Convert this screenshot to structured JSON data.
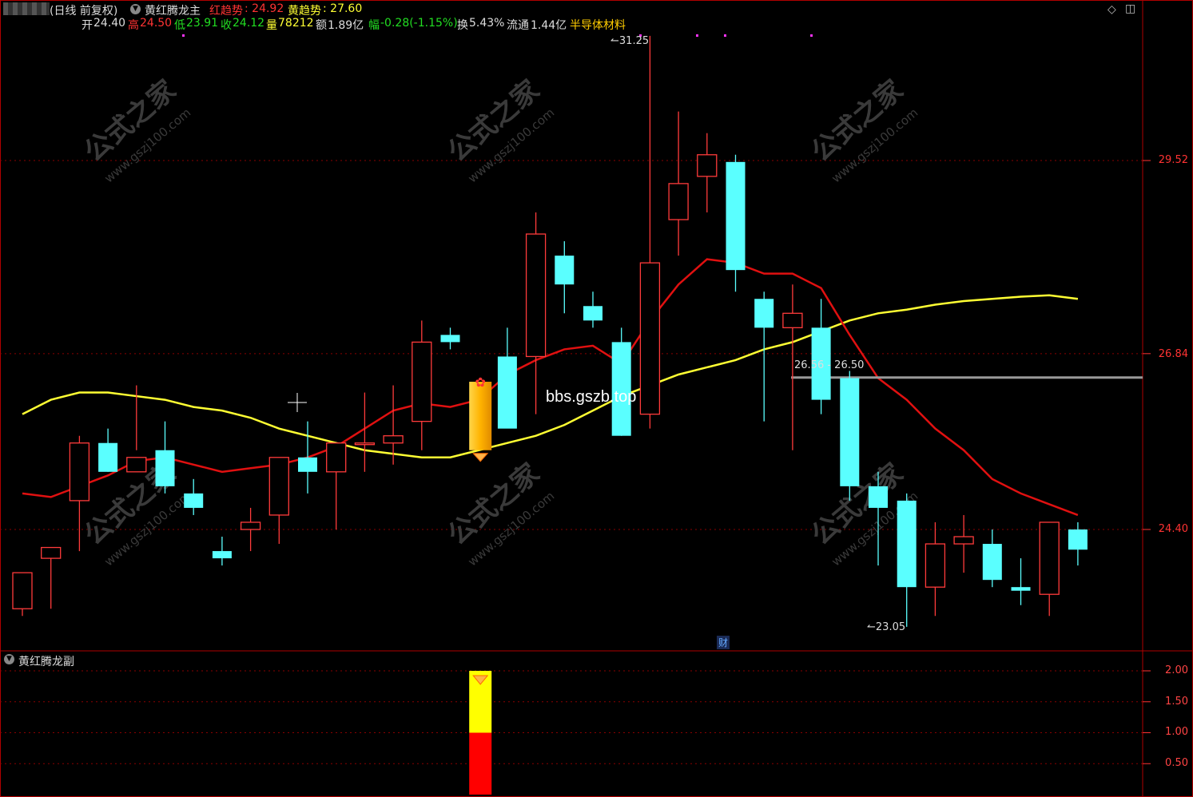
{
  "header": {
    "period_label": "(日线 前复权)",
    "indicator_name": "黄红腾龙主",
    "red_trend_label": "红趋势",
    "red_trend_value": ": 24.92",
    "yellow_trend_label": "黄趋势",
    "yellow_trend_value": ": 27.60"
  },
  "quote": {
    "open_label": "开",
    "open_value": "24.40",
    "high_label": "高",
    "high_value": "24.50",
    "low_label": "低",
    "low_value": "23.91",
    "close_label": "收",
    "close_value": "24.12",
    "volume_label": "量",
    "volume_value": "78212",
    "amount_label": "额",
    "amount_value": "1.89亿",
    "change_label": "幅",
    "change_value": "-0.28(-1.15%)",
    "turnover_label": "换",
    "turnover_value": "5.43%",
    "float_label": "流通",
    "float_value": "1.44亿",
    "sector": "半导体材料"
  },
  "main_axis": {
    "labels": [
      "29.52",
      "26.84",
      "24.40"
    ]
  },
  "annotations": {
    "high_marker": "31.25",
    "low_marker": "23.05",
    "price_range": "26.56 - 26.50",
    "watermark_center": "bbs.gszb.top",
    "finance_badge": "财",
    "watermark_cn": "公式之家",
    "watermark_url": "www.gszj100.com"
  },
  "sub_panel": {
    "indicator_name": "黄红腾龙副",
    "axis_labels": [
      "2.00",
      "1.50",
      "1.00",
      "0.50"
    ],
    "bar_total": 2.0,
    "bar_red": 1.0,
    "bar_yellow": 1.0
  },
  "colors": {
    "up": "#ff3b3b",
    "down": "#5affff",
    "red_line": "#e01010",
    "yellow_line": "#ffff33",
    "grid": "#8b0000",
    "signal_gold": "#ffb300"
  },
  "chart_data": {
    "type": "candlestick",
    "y_axis_ticks": [
      24.4,
      26.84,
      29.52
    ],
    "candles": [
      {
        "o": 23.3,
        "h": 23.7,
        "l": 23.2,
        "c": 23.8
      },
      {
        "o": 24.0,
        "h": 24.1,
        "l": 23.3,
        "c": 24.15
      },
      {
        "o": 24.8,
        "h": 25.7,
        "l": 24.1,
        "c": 25.6
      },
      {
        "o": 25.6,
        "h": 25.8,
        "l": 25.2,
        "c": 25.2
      },
      {
        "o": 25.2,
        "h": 26.4,
        "l": 25.5,
        "c": 25.4
      },
      {
        "o": 25.5,
        "h": 25.9,
        "l": 24.9,
        "c": 25.0
      },
      {
        "o": 24.9,
        "h": 25.1,
        "l": 24.6,
        "c": 24.7
      },
      {
        "o": 24.1,
        "h": 24.3,
        "l": 23.9,
        "c": 24.0
      },
      {
        "o": 24.4,
        "h": 24.7,
        "l": 24.1,
        "c": 24.5
      },
      {
        "o": 24.6,
        "h": 25.0,
        "l": 24.2,
        "c": 25.4
      },
      {
        "o": 25.4,
        "h": 25.9,
        "l": 24.9,
        "c": 25.2
      },
      {
        "o": 25.2,
        "h": 25.6,
        "l": 24.4,
        "c": 25.6
      },
      {
        "o": 25.6,
        "h": 26.3,
        "l": 25.2,
        "c": 25.6
      },
      {
        "o": 25.6,
        "h": 26.4,
        "l": 25.3,
        "c": 25.7
      },
      {
        "o": 25.9,
        "h": 27.3,
        "l": 25.5,
        "c": 27.0
      },
      {
        "o": 27.1,
        "h": 27.2,
        "l": 26.9,
        "c": 27.0
      },
      {
        "o": 27.0,
        "h": 26.9,
        "l": 25.3,
        "c": 26.3
      },
      {
        "o": 26.8,
        "h": 27.2,
        "l": 26.4,
        "c": 25.8
      },
      {
        "o": 26.8,
        "h": 28.8,
        "l": 26.0,
        "c": 28.5
      },
      {
        "o": 28.2,
        "h": 28.4,
        "l": 27.4,
        "c": 27.8
      },
      {
        "o": 27.5,
        "h": 27.7,
        "l": 27.2,
        "c": 27.3
      },
      {
        "o": 27.0,
        "h": 27.2,
        "l": 25.7,
        "c": 25.7
      },
      {
        "o": 26.0,
        "h": 31.25,
        "l": 25.8,
        "c": 28.1
      },
      {
        "o": 28.7,
        "h": 30.2,
        "l": 28.2,
        "c": 29.2
      },
      {
        "o": 29.3,
        "h": 29.9,
        "l": 28.8,
        "c": 29.6
      },
      {
        "o": 29.5,
        "h": 29.6,
        "l": 27.7,
        "c": 28.0
      },
      {
        "o": 27.6,
        "h": 27.7,
        "l": 25.9,
        "c": 27.2
      },
      {
        "o": 27.2,
        "h": 27.8,
        "l": 25.5,
        "c": 27.4
      },
      {
        "o": 27.2,
        "h": 27.6,
        "l": 26.0,
        "c": 26.2
      },
      {
        "o": 26.5,
        "h": 26.6,
        "l": 24.8,
        "c": 25.0
      },
      {
        "o": 25.0,
        "h": 25.2,
        "l": 23.9,
        "c": 24.7
      },
      {
        "o": 24.8,
        "h": 24.9,
        "l": 23.05,
        "c": 23.6
      },
      {
        "o": 23.6,
        "h": 24.5,
        "l": 23.2,
        "c": 24.2
      },
      {
        "o": 24.2,
        "h": 24.6,
        "l": 23.8,
        "c": 24.3
      },
      {
        "o": 24.2,
        "h": 24.4,
        "l": 23.6,
        "c": 23.7
      },
      {
        "o": 23.6,
        "h": 24.0,
        "l": 23.35,
        "c": 23.55
      },
      {
        "o": 23.5,
        "h": 24.5,
        "l": 23.2,
        "c": 24.5
      },
      {
        "o": 24.4,
        "h": 24.5,
        "l": 23.9,
        "c": 24.12
      }
    ],
    "red_trend": [
      24.9,
      24.85,
      25.0,
      25.15,
      25.35,
      25.4,
      25.3,
      25.2,
      25.25,
      25.3,
      25.4,
      25.55,
      25.8,
      26.05,
      26.15,
      26.1,
      26.2,
      26.55,
      26.75,
      26.9,
      26.95,
      26.7,
      27.3,
      27.8,
      28.15,
      28.1,
      27.95,
      27.95,
      27.75,
      27.1,
      26.5,
      26.2,
      25.8,
      25.5,
      25.1,
      24.9,
      24.75,
      24.6
    ],
    "yellow_trend": [
      26.0,
      26.2,
      26.3,
      26.3,
      26.25,
      26.2,
      26.1,
      26.05,
      25.95,
      25.8,
      25.7,
      25.6,
      25.5,
      25.45,
      25.4,
      25.4,
      25.5,
      25.6,
      25.7,
      25.85,
      26.05,
      26.25,
      26.4,
      26.55,
      26.65,
      26.75,
      26.9,
      27.0,
      27.15,
      27.3,
      27.4,
      27.45,
      27.52,
      27.57,
      27.6,
      27.63,
      27.65,
      27.6
    ],
    "signal_bar_index": 16,
    "sub_indicator": {
      "index": 16,
      "red": 1.0,
      "yellow": 1.0,
      "ylim": [
        0,
        2.0
      ]
    }
  }
}
